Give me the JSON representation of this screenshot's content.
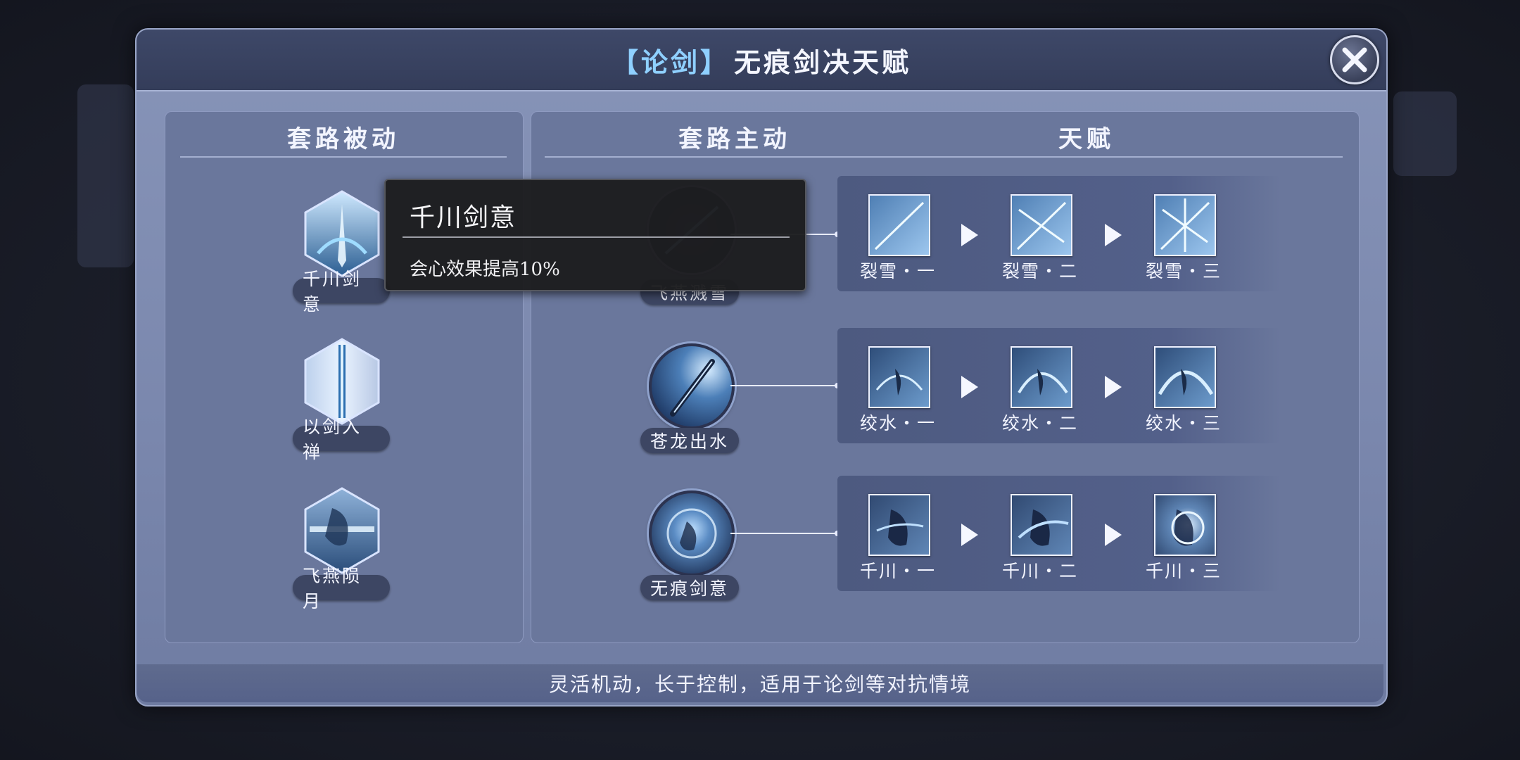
{
  "header": {
    "tag": "【论剑】",
    "title": "无痕剑决天赋"
  },
  "columns": {
    "passive": "套路被动",
    "active": "套路主动",
    "talent": "天赋"
  },
  "passives": [
    {
      "name": "千川剑意",
      "icon": "sword-burst-icon"
    },
    {
      "name": "以剑入禅",
      "icon": "sword-wings-icon"
    },
    {
      "name": "飞燕陨月",
      "icon": "swallow-moon-icon"
    }
  ],
  "actives": [
    {
      "name": "飞燕溅雪",
      "icon": "sword-slash-icon"
    },
    {
      "name": "苍龙出水",
      "icon": "dragon-sword-icon"
    },
    {
      "name": "无痕剑意",
      "icon": "swordsman-orb-icon"
    }
  ],
  "talent_rows": [
    {
      "items": [
        "裂雪・一",
        "裂雪・二",
        "裂雪・三"
      ]
    },
    {
      "items": [
        "绞水・一",
        "绞水・二",
        "绞水・三"
      ]
    },
    {
      "items": [
        "千川・一",
        "千川・二",
        "千川・三"
      ]
    }
  ],
  "tooltip": {
    "title": "千川剑意",
    "desc": "会心效果提高10%"
  },
  "footer": "灵活机动，长于控制，适用于论剑等对抗情境",
  "colors": {
    "accent": "#8fd0ff",
    "panel": "#7a87ad",
    "header": "#3e4868"
  }
}
